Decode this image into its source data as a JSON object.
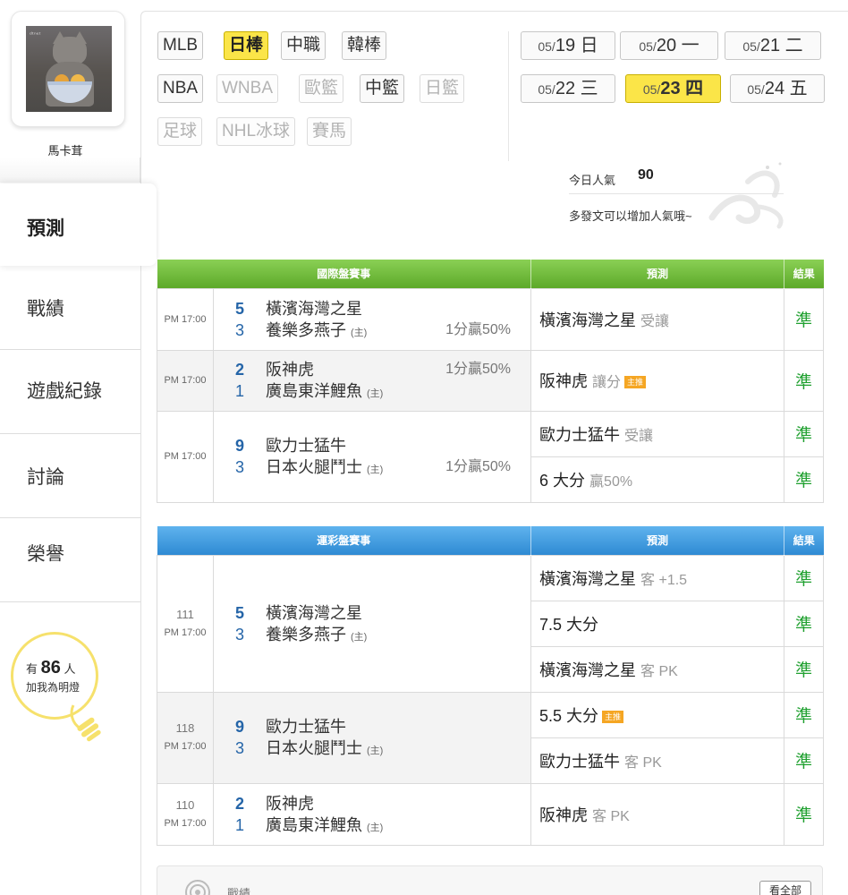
{
  "user": {
    "name": "馬卡茸",
    "avatar_watermark": "ᵈᵗⁿᵉᵗ"
  },
  "nav": {
    "active": "預測",
    "items": [
      "戰績",
      "遊戲紀錄",
      "討論",
      "榮譽"
    ]
  },
  "fans": {
    "prefix": "有",
    "count": "86",
    "suffix": "人",
    "line2": "加我為明燈"
  },
  "leagues": {
    "row1": [
      "MLB",
      "日棒",
      "中職",
      "韓棒"
    ],
    "row2": [
      "NBA",
      "WNBA",
      "歐籃",
      "中籃",
      "日籃"
    ],
    "row3": [
      "足球",
      "NHL冰球",
      "賽馬"
    ],
    "selected": "日棒"
  },
  "dates": [
    {
      "md": "05/",
      "d": "19",
      "dw": "日"
    },
    {
      "md": "05/",
      "d": "20",
      "dw": "一"
    },
    {
      "md": "05/",
      "d": "21",
      "dw": "二"
    },
    {
      "md": "05/",
      "d": "22",
      "dw": "三"
    },
    {
      "md": "05/",
      "d": "23",
      "dw": "四"
    },
    {
      "md": "05/",
      "d": "24",
      "dw": "五"
    }
  ],
  "popularity": {
    "label": "今日人氣",
    "value": "90",
    "hint": "多發文可以增加人氣哦~"
  },
  "intl": {
    "headers": [
      "國際盤賽事",
      "預測",
      "結果"
    ],
    "games": [
      {
        "time": "PM 17:00",
        "s1": "5",
        "t1": "橫濱海灣之星",
        "s2": "3",
        "t2": "養樂多燕子",
        "home": "(主)",
        "odds_row": 2,
        "odds": "1分贏50%",
        "preds": [
          {
            "main": "橫濱海灣之星",
            "sub": "受讓",
            "badge": "",
            "res": "準"
          }
        ]
      },
      {
        "time": "PM 17:00",
        "s1": "2",
        "t1": "阪神虎",
        "s2": "1",
        "t2": "廣島東洋鯉魚",
        "home": "(主)",
        "odds_row": 1,
        "odds": "1分贏50%",
        "preds": [
          {
            "main": "阪神虎",
            "sub": "讓分",
            "badge": "主推",
            "res": "準"
          }
        ]
      },
      {
        "time": "PM 17:00",
        "s1": "9",
        "t1": "歐力士猛牛",
        "s2": "3",
        "t2": "日本火腿鬥士",
        "home": "(主)",
        "odds_row": 2,
        "odds": "1分贏50%",
        "preds": [
          {
            "main": "歐力士猛牛",
            "sub": "受讓",
            "badge": "",
            "res": "準"
          },
          {
            "main": "6 大分",
            "sub": "贏50%",
            "badge": "",
            "res": "準"
          }
        ]
      }
    ]
  },
  "lottery": {
    "headers": [
      "運彩盤賽事",
      "預測",
      "結果"
    ],
    "games": [
      {
        "no": "111",
        "time": "PM 17:00",
        "s1": "5",
        "t1": "橫濱海灣之星",
        "s2": "3",
        "t2": "養樂多燕子",
        "home": "(主)",
        "preds": [
          {
            "main": "橫濱海灣之星",
            "sub": "客 +1.5",
            "badge": "",
            "res": "準"
          },
          {
            "main": "7.5 大分",
            "sub": "",
            "badge": "",
            "res": "準"
          },
          {
            "main": "橫濱海灣之星",
            "sub": "客 PK",
            "badge": "",
            "res": "準"
          }
        ]
      },
      {
        "no": "118",
        "time": "PM 17:00",
        "s1": "9",
        "t1": "歐力士猛牛",
        "s2": "3",
        "t2": "日本火腿鬥士",
        "home": "(主)",
        "preds": [
          {
            "main": "5.5 大分",
            "sub": "",
            "badge": "主推",
            "res": "準"
          },
          {
            "main": "歐力士猛牛",
            "sub": "客 PK",
            "badge": "",
            "res": "準"
          }
        ]
      },
      {
        "no": "110",
        "time": "PM 17:00",
        "s1": "2",
        "t1": "阪神虎",
        "s2": "1",
        "t2": "廣島東洋鯉魚",
        "home": "(主)",
        "preds": [
          {
            "main": "阪神虎",
            "sub": "客 PK",
            "badge": "",
            "res": "準"
          }
        ]
      }
    ]
  },
  "record": {
    "label": "戰績",
    "see_all": "看全部"
  },
  "colors": {
    "accent_yellow": "#fbe548",
    "intl_green": "#5da929",
    "lottery_blue": "#2e8ad3",
    "correct_green": "#21a131",
    "score_blue": "#2565a8"
  },
  "icons": [
    "avatar-photo",
    "bulb-icon",
    "swirl-decoration",
    "record-target-icon"
  ]
}
